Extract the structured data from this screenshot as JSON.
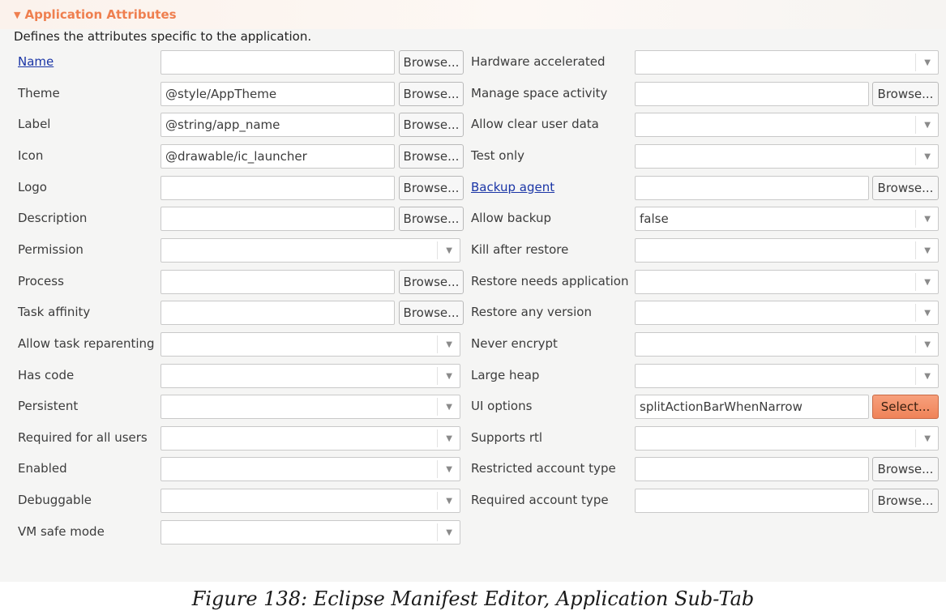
{
  "section": {
    "title": "Application Attributes",
    "description": "Defines the attributes specific to the application."
  },
  "left_rows": [
    {
      "label": "Name",
      "link": true,
      "kind": "text",
      "value": "",
      "button": "Browse..."
    },
    {
      "label": "Theme",
      "kind": "text",
      "value": "@style/AppTheme",
      "button": "Browse..."
    },
    {
      "label": "Label",
      "kind": "text",
      "value": "@string/app_name",
      "button": "Browse..."
    },
    {
      "label": "Icon",
      "kind": "text",
      "value": "@drawable/ic_launcher",
      "button": "Browse..."
    },
    {
      "label": "Logo",
      "kind": "text",
      "value": "",
      "button": "Browse..."
    },
    {
      "label": "Description",
      "kind": "text",
      "value": "",
      "button": "Browse..."
    },
    {
      "label": "Permission",
      "kind": "combo",
      "value": ""
    },
    {
      "label": "Process",
      "kind": "text",
      "value": "",
      "button": "Browse..."
    },
    {
      "label": "Task affinity",
      "kind": "text",
      "value": "",
      "button": "Browse..."
    },
    {
      "label": "Allow task reparenting",
      "kind": "combo",
      "value": ""
    },
    {
      "label": "Has code",
      "kind": "combo",
      "value": ""
    },
    {
      "label": "Persistent",
      "kind": "combo",
      "value": ""
    },
    {
      "label": "Required for all users",
      "kind": "combo",
      "value": ""
    },
    {
      "label": "Enabled",
      "kind": "combo",
      "value": ""
    },
    {
      "label": "Debuggable",
      "kind": "combo",
      "value": ""
    },
    {
      "label": "VM safe mode",
      "kind": "combo",
      "value": ""
    }
  ],
  "right_rows": [
    {
      "label": "Hardware accelerated",
      "kind": "combo",
      "value": ""
    },
    {
      "label": "Manage space activity",
      "kind": "text",
      "value": "",
      "button": "Browse..."
    },
    {
      "label": "Allow clear user data",
      "kind": "combo",
      "value": ""
    },
    {
      "label": "Test only",
      "kind": "combo",
      "value": ""
    },
    {
      "label": "Backup agent",
      "link": true,
      "kind": "text",
      "value": "",
      "button": "Browse..."
    },
    {
      "label": "Allow backup",
      "kind": "combo",
      "value": "false"
    },
    {
      "label": "Kill after restore",
      "kind": "combo",
      "value": ""
    },
    {
      "label": "Restore needs application",
      "kind": "combo",
      "value": ""
    },
    {
      "label": "Restore any version",
      "kind": "combo",
      "value": ""
    },
    {
      "label": "Never encrypt",
      "kind": "combo",
      "value": ""
    },
    {
      "label": "Large heap",
      "kind": "combo",
      "value": ""
    },
    {
      "label": "UI options",
      "kind": "text",
      "value": "splitActionBarWhenNarrow",
      "button": "Select...",
      "button_highlight": true
    },
    {
      "label": "Supports rtl",
      "kind": "combo",
      "value": ""
    },
    {
      "label": "Restricted account type",
      "kind": "text",
      "value": "",
      "button": "Browse..."
    },
    {
      "label": "Required account type",
      "kind": "text",
      "value": "",
      "button": "Browse..."
    }
  ],
  "icons": {
    "collapse": "triangle-down-icon",
    "dropdown": "chevron-down-icon"
  },
  "colors": {
    "section_title": "#ef7f4f",
    "link": "#1a35a6",
    "select_button": "#ef8359"
  },
  "caption": "Figure 138: Eclipse Manifest Editor, Application Sub-Tab"
}
